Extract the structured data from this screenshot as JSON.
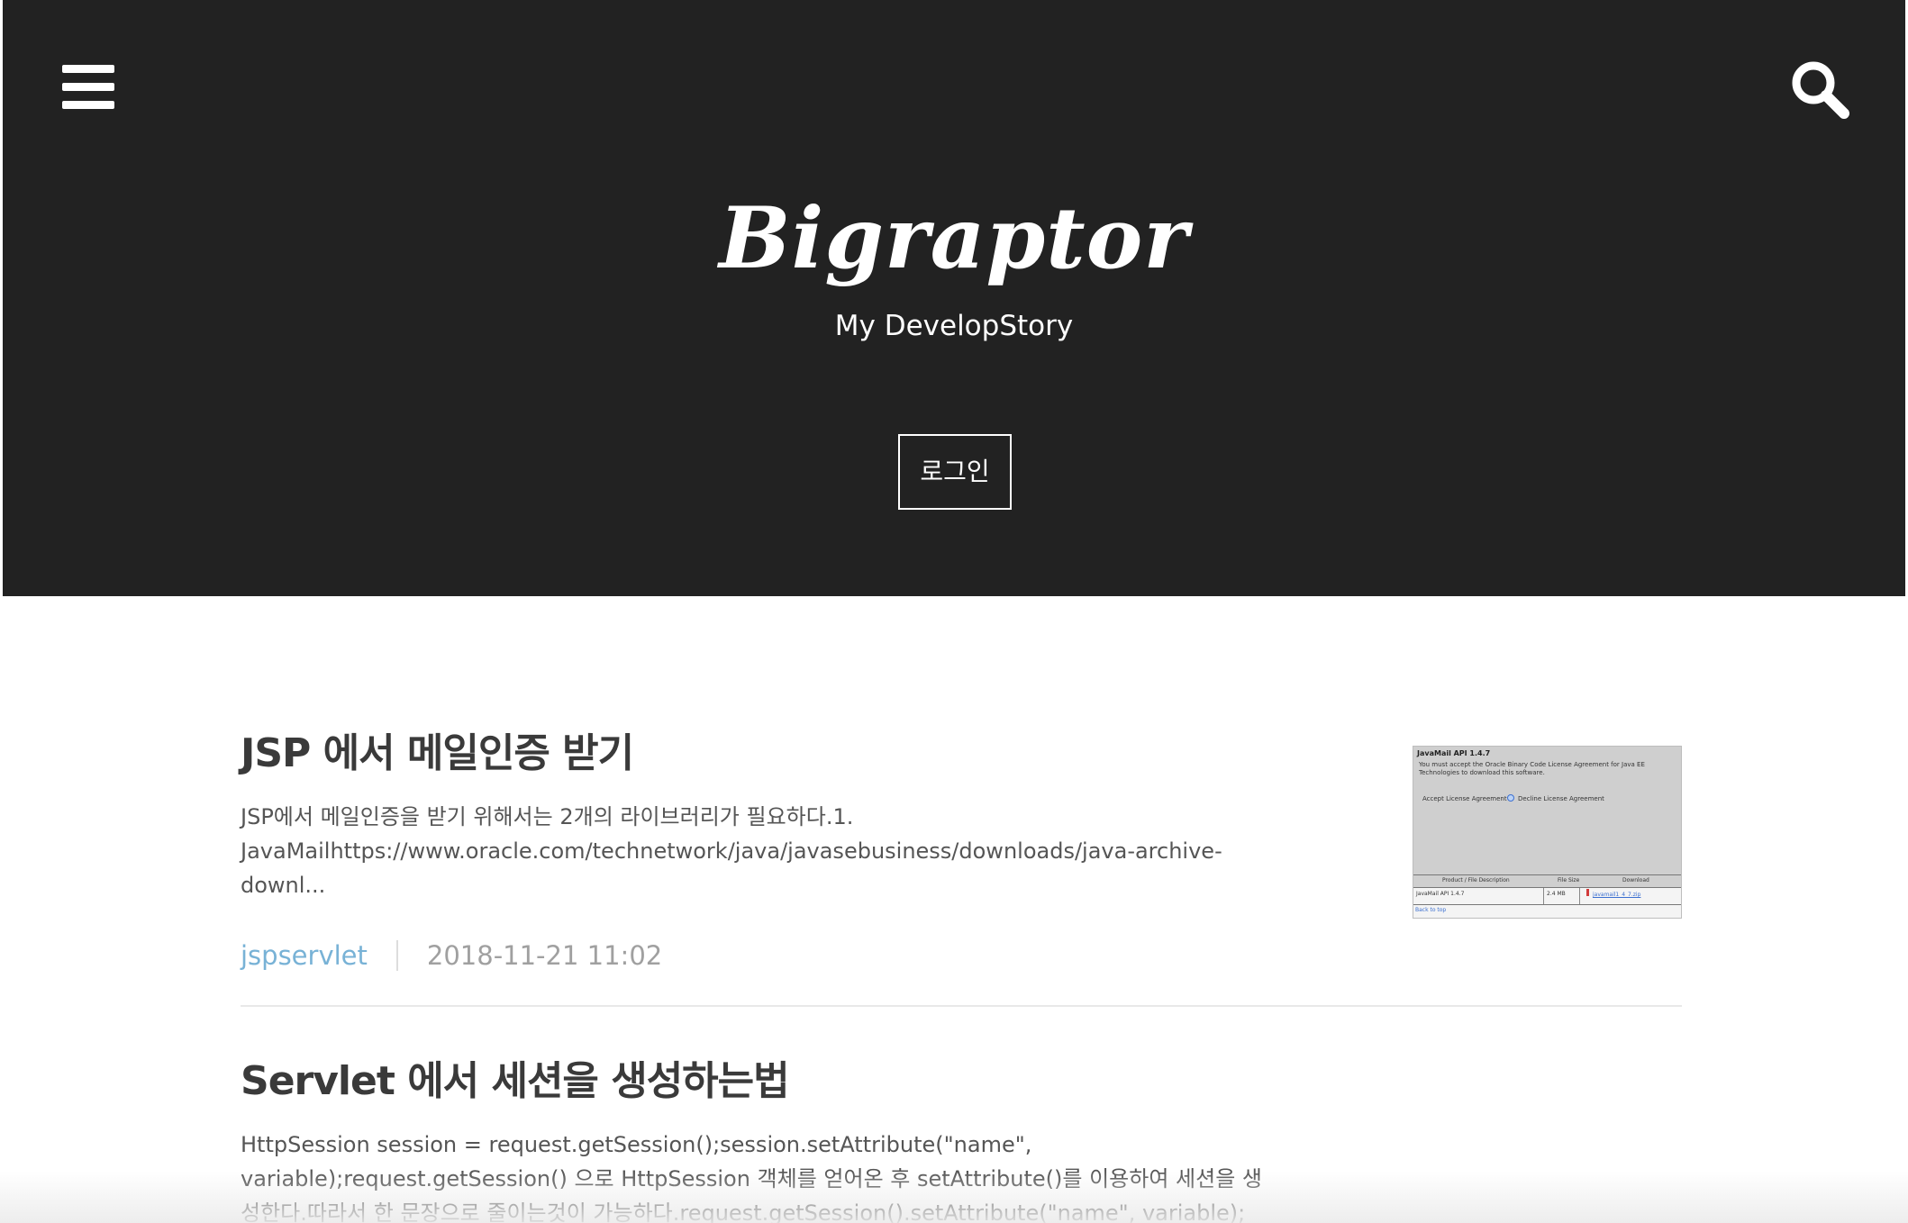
{
  "header": {
    "title": "Bigraptor",
    "description": "My DevelopStory",
    "login_label": "로그인",
    "menu_icon": "hamburger-menu-icon",
    "search_icon": "search-icon",
    "background_color": "#222222"
  },
  "posts": [
    {
      "title": "JSP 에서 메일인증 받기",
      "excerpt": "JSP에서 메일인증을 받기 위해서는 2개의 라이브러리가 필요하다.1. JavaMailhttps://www.oracle.com/technetwork/java/javasebusiness/downloads/java-archive-downl...",
      "category": "jspservlet",
      "date": "2018-11-21 11:02",
      "thumbnail": {
        "heading": "JavaMail API 1.4.7",
        "notice": "You must accept the Oracle Binary Code License Agreement for Java EE Technologies to download this software.",
        "accept_label": "Accept License Agreement",
        "decline_label": "Decline License Agreement",
        "col_product": "Product / File Description",
        "col_size": "File Size",
        "col_download": "Download",
        "row_product": "JavaMail API 1.4.7",
        "row_size": "2.4 MB",
        "row_file": "javamail1_4_7.zip",
        "back_link": "Back to top"
      }
    },
    {
      "title": "Servlet 에서 세션을 생성하는법",
      "excerpt": "HttpSession session = request.getSession();session.setAttribute(\"name\", variable);request.getSession() 으로 HttpSession 객체를 얻어온 후 setAttribute()를 이용하여 세션을 생성한다.따라서 한 문장으로 줄이는것이 가능하다.request.getSession().setAttribute(\"name\", variable);"
    }
  ],
  "colors": {
    "category_link": "#78b2d6",
    "date_text": "#a0a0a0",
    "title_text": "#3a3a3a"
  }
}
